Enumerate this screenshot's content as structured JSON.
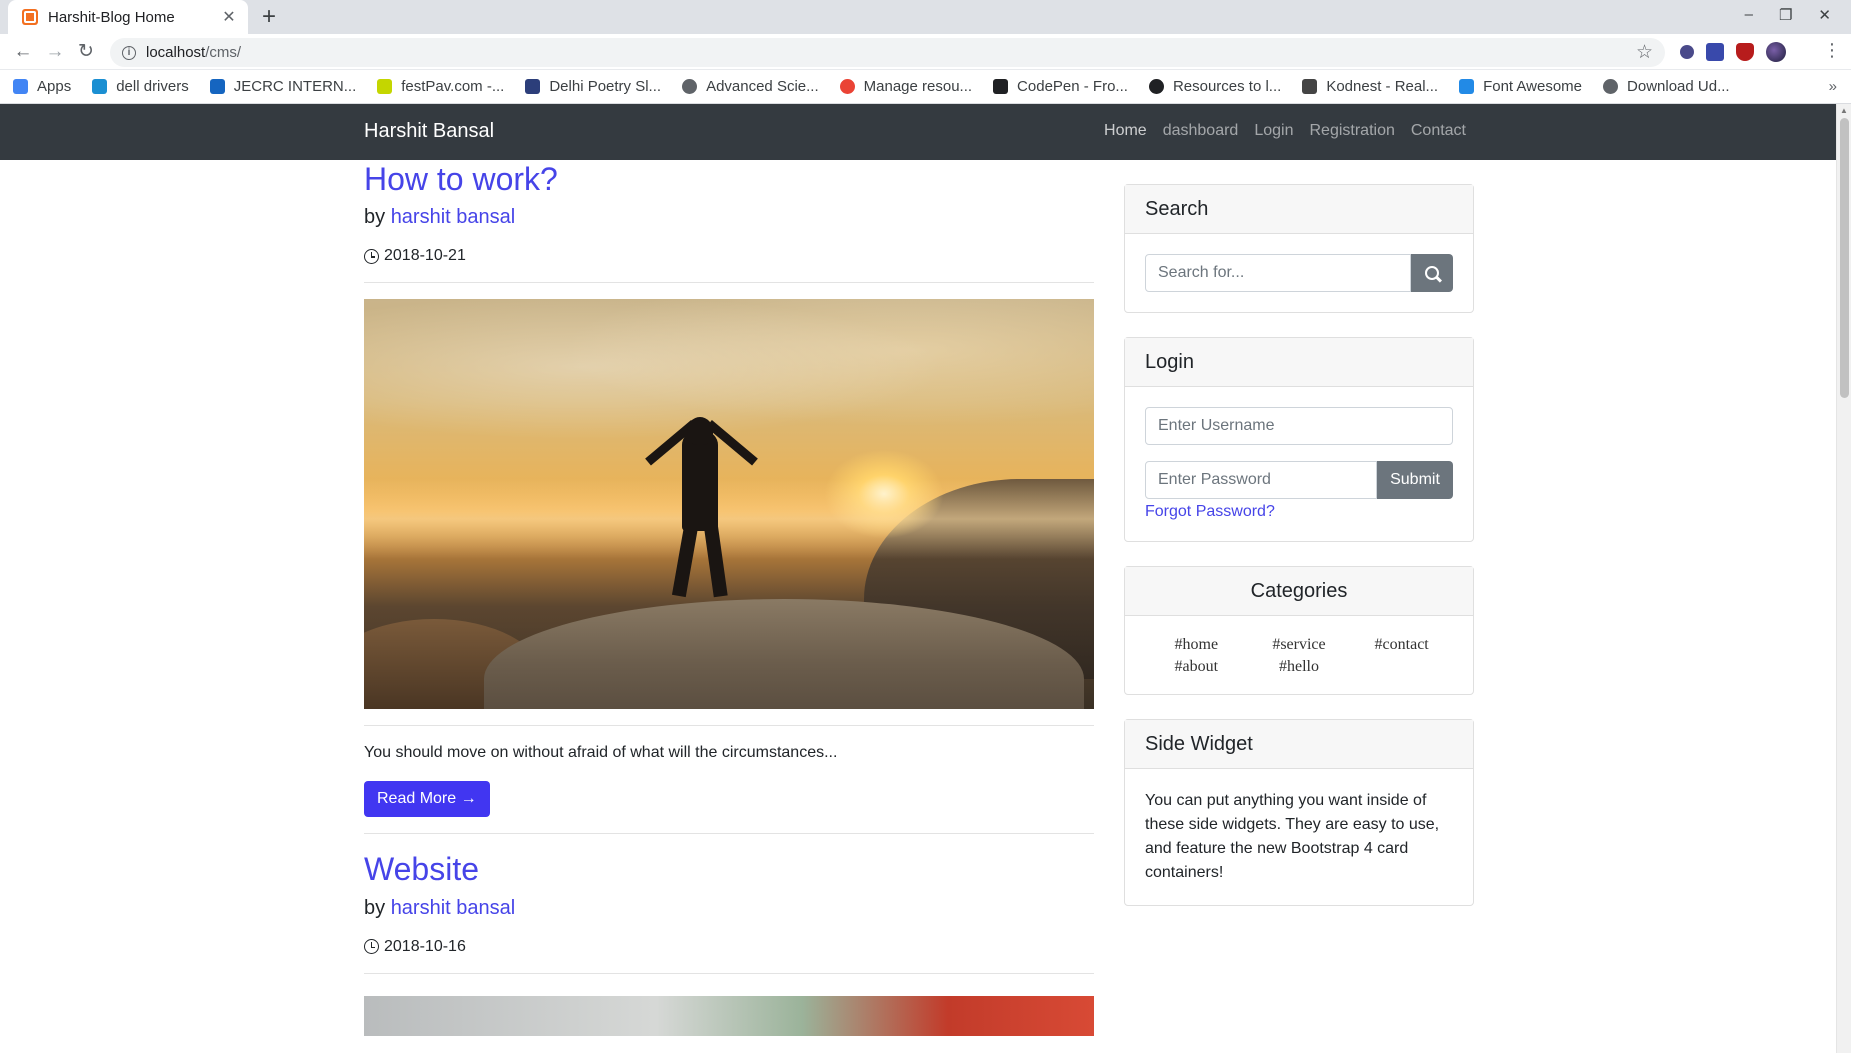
{
  "browser": {
    "tab_title": "Harshit-Blog Home",
    "url_host": "localhost",
    "url_path": "/cms/",
    "bookmarks": [
      {
        "label": "Apps",
        "color": "#4285f4"
      },
      {
        "label": "dell drivers",
        "color": "#1b8fd2"
      },
      {
        "label": "JECRC INTERN...",
        "color": "#1565c0"
      },
      {
        "label": "festPav.com -...",
        "color": "#c4d600"
      },
      {
        "label": "Delhi Poetry Sl...",
        "color": "#2c3e7a"
      },
      {
        "label": "Advanced Scie...",
        "color": "#5f6368"
      },
      {
        "label": "Manage resou...",
        "color": "#ea4335"
      },
      {
        "label": "CodePen - Fro...",
        "color": "#202124"
      },
      {
        "label": "Resources to l...",
        "color": "#202124"
      },
      {
        "label": "Kodnest - Real...",
        "color": "#444444"
      },
      {
        "label": "Font Awesome",
        "color": "#228ae6"
      },
      {
        "label": "Download Ud...",
        "color": "#5f6368"
      }
    ]
  },
  "navbar": {
    "brand": "Harshit Bansal",
    "links": [
      "Home",
      "dashboard",
      "Login",
      "Registration",
      "Contact"
    ]
  },
  "posts": [
    {
      "title": "How to work?",
      "by": "by",
      "author": "harshit bansal",
      "date": "2018-10-21",
      "excerpt": "You should move on without afraid of what will the circumstances...",
      "read_more": "Read More →"
    },
    {
      "title": "Website",
      "by": "by",
      "author": "harshit bansal",
      "date": "2018-10-16"
    }
  ],
  "sidebar": {
    "search": {
      "title": "Search",
      "placeholder": "Search for..."
    },
    "login": {
      "title": "Login",
      "username_placeholder": "Enter Username",
      "password_placeholder": "Enter Password",
      "submit": "Submit",
      "forgot": "Forgot Password?"
    },
    "categories": {
      "title": "Categories",
      "items": [
        "#home",
        "#service",
        "#contact",
        "#about",
        "#hello"
      ]
    },
    "widget": {
      "title": "Side Widget",
      "text": "You can put anything you want inside of these side widgets. They are easy to use, and feature the new Bootstrap 4 card containers!"
    }
  },
  "colors": {
    "navbar_bg": "#343a40",
    "link": "#4644e8",
    "primary_button": "#4136f1",
    "secondary_button": "#6c757d"
  }
}
